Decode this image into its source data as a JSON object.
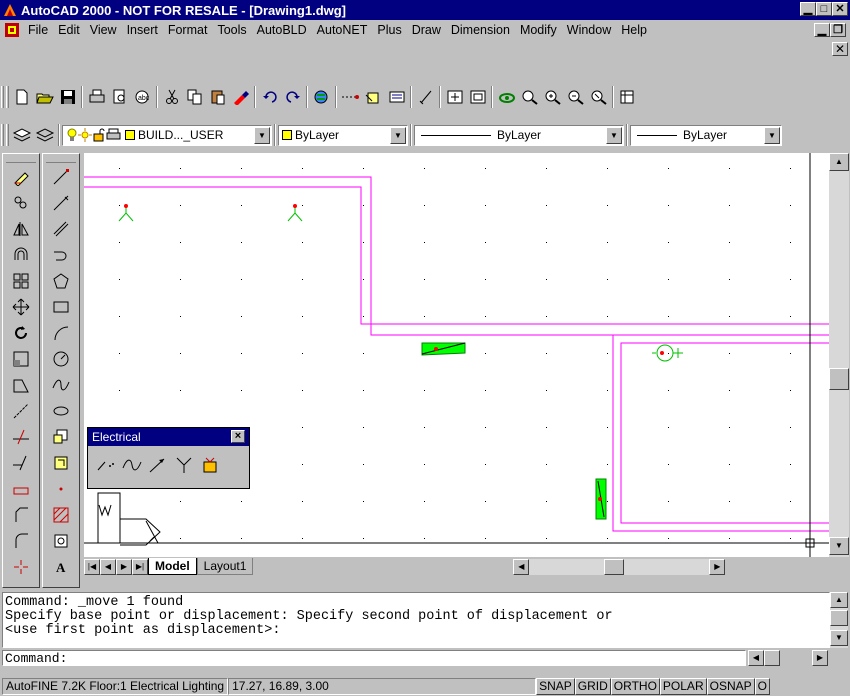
{
  "window": {
    "title": "AutoCAD 2000 - NOT FOR RESALE - [Drawing1.dwg]",
    "caption_buttons": [
      "minimize",
      "maximize",
      "close"
    ]
  },
  "menu": {
    "items": [
      "File",
      "Edit",
      "View",
      "Insert",
      "Format",
      "Tools",
      "AutoBLD",
      "AutoNET",
      "Plus",
      "Draw",
      "Dimension",
      "Modify",
      "Window",
      "Help"
    ]
  },
  "standard_toolbar": {
    "icons": [
      "new-icon",
      "open-icon",
      "save-icon",
      "print-icon",
      "preview-icon",
      "spell-icon",
      "cut-icon",
      "copy-icon",
      "paste-icon",
      "matchprop-icon",
      "undo-icon",
      "redo-icon",
      "hyperlink-icon",
      "tracking-icon",
      "insert-icon",
      "properties-icon",
      "dist-icon",
      "pan-icon",
      "zoom-realtime-icon",
      "zoom-window-icon",
      "zoom-prev-icon",
      "zoom-extents-icon",
      "dbconnect-icon"
    ]
  },
  "properties_toolbar": {
    "layer_value": "BUILD..._USER",
    "color_value": "ByLayer",
    "linetype_value": "ByLayer",
    "lineweight_value": "ByLayer",
    "layer_color": "#ffff00"
  },
  "tabs": {
    "active": "Model",
    "items": [
      "Model",
      "Layout1"
    ]
  },
  "electrical_toolbar": {
    "title": "Electrical",
    "close_label": "×"
  },
  "command": {
    "history": [
      "Command: _move 1 found",
      "Specify base point or displacement: Specify second point of displacement or",
      "<use first point as displacement>:"
    ],
    "prompt": "Command:"
  },
  "status": {
    "app_info": "AutoFINE 7.2K Floor:1 Electrical Lighting",
    "coords": "17.27, 16.89, 3.00",
    "toggles": [
      "SNAP",
      "GRID",
      "ORTHO",
      "POLAR",
      "OSNAP",
      "O"
    ]
  },
  "colors": {
    "title_bg": "#000080",
    "wall_color": "#ff00ff",
    "symbol_color": "#00ff00",
    "marker_color": "#ff0000"
  }
}
